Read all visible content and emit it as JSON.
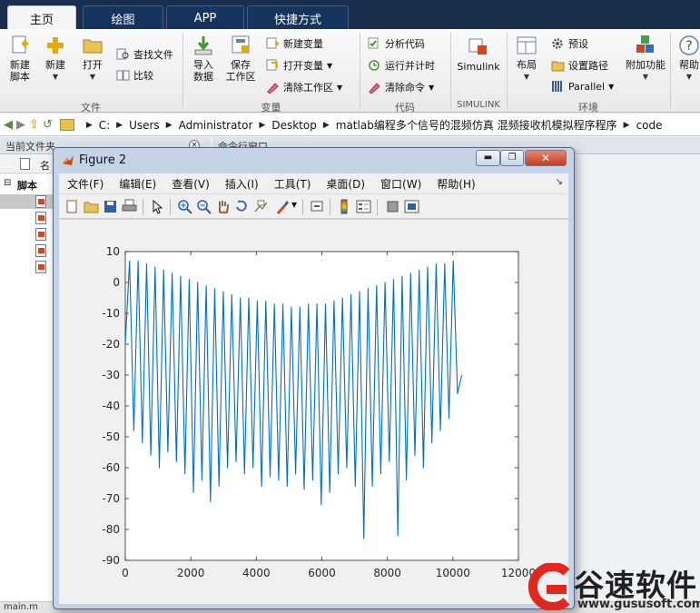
{
  "tabs": [
    {
      "label": "主页",
      "active": true
    },
    {
      "label": "绘图",
      "active": false
    },
    {
      "label": "APP",
      "active": false
    },
    {
      "label": "快捷方式",
      "active": false
    }
  ],
  "ribbon": {
    "file": {
      "new_script": "新建\n脚本",
      "new": "新建",
      "open": "打开",
      "find_files": "查找文件",
      "compare": "比较",
      "group_label": "文件"
    },
    "variable": {
      "import_data": "导入\n数据",
      "save_workspace": "保存\n工作区",
      "new_variable": "新建变量",
      "open_variable": "打开变量",
      "clear_workspace": "清除工作区",
      "group_label": "变量"
    },
    "code": {
      "analyze_code": "分析代码",
      "run_and_time": "运行并计时",
      "clear_commands": "清除命令",
      "group_label": "代码"
    },
    "simulink": {
      "label": "Simulink",
      "group_label": "SIMULINK"
    },
    "environment": {
      "layout": "布局",
      "preferences": "预设",
      "set_path": "设置路径",
      "parallel": "Parallel",
      "addons": "附加功能",
      "group_label": "环境"
    },
    "help": {
      "label": "帮助"
    }
  },
  "address": {
    "crumbs": [
      "C:",
      "Users",
      "Administrator",
      "Desktop",
      "matlab编程多个信号的混频仿真 混频接收机模拟程序程序",
      "code"
    ]
  },
  "panes": {
    "current_folder_title": "当前文件夹",
    "name_column": "名",
    "script_node": "脚本",
    "command_window_title": "命令行窗口",
    "status_text": "main.m"
  },
  "figure": {
    "title": "Figure 2",
    "menu": [
      "文件(F)",
      "编辑(E)",
      "查看(V)",
      "插入(I)",
      "工具(T)",
      "桌面(D)",
      "窗口(W)",
      "帮助(H)"
    ],
    "icons": {
      "minimize": "minimize-icon",
      "restore": "restore-icon",
      "close": "close-icon"
    }
  },
  "chart_data": {
    "type": "line",
    "title": "",
    "xlabel": "",
    "ylabel": "",
    "xlim": [
      0,
      12000
    ],
    "ylim": [
      -90,
      10
    ],
    "xticks": [
      0,
      2000,
      4000,
      6000,
      8000,
      10000,
      12000
    ],
    "yticks": [
      10,
      0,
      -10,
      -20,
      -30,
      -40,
      -50,
      -60,
      -70,
      -80,
      -90
    ],
    "grid": false,
    "color": "#0072BD",
    "series": [
      {
        "x": [
          0,
          130,
          260,
          390,
          520,
          650,
          780,
          910,
          1040,
          1170,
          1300,
          1430,
          1560,
          1690,
          1820,
          1950,
          2080,
          2210,
          2340,
          2470,
          2600,
          2730,
          2860,
          2990,
          3120,
          3250,
          3380,
          3510,
          3640,
          3770,
          3900,
          4030,
          4160,
          4290,
          4420,
          4550,
          4680,
          4810,
          4940,
          5070,
          5200,
          5330,
          5460,
          5590,
          5720,
          5850,
          5980,
          6110,
          6240,
          6370,
          6500,
          6630,
          6760,
          6890,
          7020,
          7150,
          7280,
          7410,
          7540,
          7670,
          7800,
          7930,
          8060,
          8190,
          8320,
          8450,
          8580,
          8710,
          8840,
          8970,
          9100,
          9230,
          9360,
          9490,
          9620,
          9750,
          9880,
          10010,
          10140,
          10270
        ],
        "y": [
          -20,
          7,
          -48,
          7,
          -52,
          6,
          -56,
          5,
          -60,
          4,
          -55,
          3,
          -58,
          2,
          -62,
          1,
          -68,
          0,
          -64,
          -1,
          -71,
          -2,
          -66,
          -3,
          -60,
          -4,
          -58,
          -5,
          -62,
          -5,
          -60,
          -6,
          -66,
          -6,
          -63,
          -7,
          -64,
          -7,
          -66,
          -8,
          -62,
          -8,
          -67,
          -7,
          -64,
          -7,
          -72,
          -7,
          -68,
          -6,
          -62,
          -5,
          -60,
          -4,
          -66,
          -3,
          -83,
          -2,
          -66,
          -1,
          -62,
          0,
          -58,
          1,
          -82,
          2,
          -64,
          3,
          -56,
          4,
          -60,
          5,
          -52,
          6,
          -48,
          6,
          -44,
          7,
          -36,
          -30
        ]
      }
    ]
  },
  "watermark": {
    "brand_text": "谷速软件",
    "url": "www.gususoft.com"
  }
}
